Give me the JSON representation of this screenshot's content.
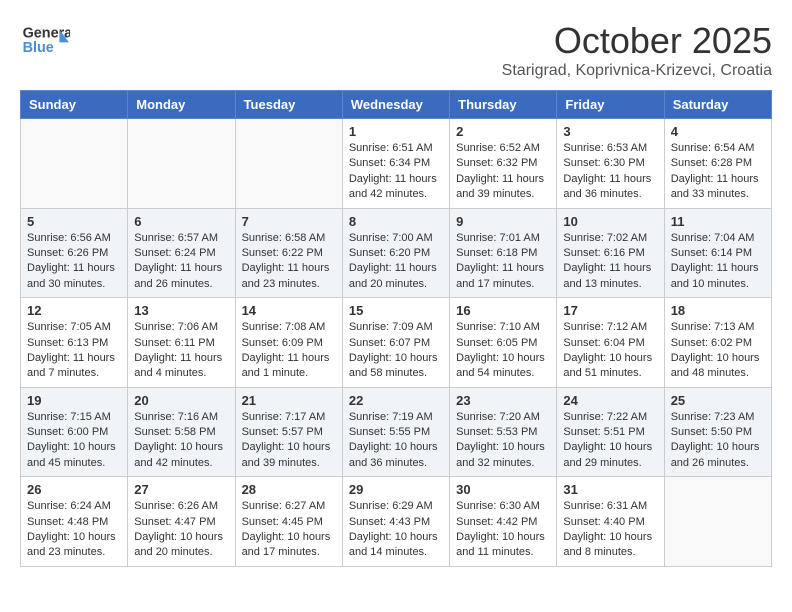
{
  "header": {
    "logo_general": "General",
    "logo_blue": "Blue",
    "month": "October 2025",
    "location": "Starigrad, Koprivnica-Krizevci, Croatia"
  },
  "weekdays": [
    "Sunday",
    "Monday",
    "Tuesday",
    "Wednesday",
    "Thursday",
    "Friday",
    "Saturday"
  ],
  "weeks": [
    [
      {
        "day": "",
        "info": ""
      },
      {
        "day": "",
        "info": ""
      },
      {
        "day": "",
        "info": ""
      },
      {
        "day": "1",
        "info": "Sunrise: 6:51 AM\nSunset: 6:34 PM\nDaylight: 11 hours\nand 42 minutes."
      },
      {
        "day": "2",
        "info": "Sunrise: 6:52 AM\nSunset: 6:32 PM\nDaylight: 11 hours\nand 39 minutes."
      },
      {
        "day": "3",
        "info": "Sunrise: 6:53 AM\nSunset: 6:30 PM\nDaylight: 11 hours\nand 36 minutes."
      },
      {
        "day": "4",
        "info": "Sunrise: 6:54 AM\nSunset: 6:28 PM\nDaylight: 11 hours\nand 33 minutes."
      }
    ],
    [
      {
        "day": "5",
        "info": "Sunrise: 6:56 AM\nSunset: 6:26 PM\nDaylight: 11 hours\nand 30 minutes."
      },
      {
        "day": "6",
        "info": "Sunrise: 6:57 AM\nSunset: 6:24 PM\nDaylight: 11 hours\nand 26 minutes."
      },
      {
        "day": "7",
        "info": "Sunrise: 6:58 AM\nSunset: 6:22 PM\nDaylight: 11 hours\nand 23 minutes."
      },
      {
        "day": "8",
        "info": "Sunrise: 7:00 AM\nSunset: 6:20 PM\nDaylight: 11 hours\nand 20 minutes."
      },
      {
        "day": "9",
        "info": "Sunrise: 7:01 AM\nSunset: 6:18 PM\nDaylight: 11 hours\nand 17 minutes."
      },
      {
        "day": "10",
        "info": "Sunrise: 7:02 AM\nSunset: 6:16 PM\nDaylight: 11 hours\nand 13 minutes."
      },
      {
        "day": "11",
        "info": "Sunrise: 7:04 AM\nSunset: 6:14 PM\nDaylight: 11 hours\nand 10 minutes."
      }
    ],
    [
      {
        "day": "12",
        "info": "Sunrise: 7:05 AM\nSunset: 6:13 PM\nDaylight: 11 hours\nand 7 minutes."
      },
      {
        "day": "13",
        "info": "Sunrise: 7:06 AM\nSunset: 6:11 PM\nDaylight: 11 hours\nand 4 minutes."
      },
      {
        "day": "14",
        "info": "Sunrise: 7:08 AM\nSunset: 6:09 PM\nDaylight: 11 hours\nand 1 minute."
      },
      {
        "day": "15",
        "info": "Sunrise: 7:09 AM\nSunset: 6:07 PM\nDaylight: 10 hours\nand 58 minutes."
      },
      {
        "day": "16",
        "info": "Sunrise: 7:10 AM\nSunset: 6:05 PM\nDaylight: 10 hours\nand 54 minutes."
      },
      {
        "day": "17",
        "info": "Sunrise: 7:12 AM\nSunset: 6:04 PM\nDaylight: 10 hours\nand 51 minutes."
      },
      {
        "day": "18",
        "info": "Sunrise: 7:13 AM\nSunset: 6:02 PM\nDaylight: 10 hours\nand 48 minutes."
      }
    ],
    [
      {
        "day": "19",
        "info": "Sunrise: 7:15 AM\nSunset: 6:00 PM\nDaylight: 10 hours\nand 45 minutes."
      },
      {
        "day": "20",
        "info": "Sunrise: 7:16 AM\nSunset: 5:58 PM\nDaylight: 10 hours\nand 42 minutes."
      },
      {
        "day": "21",
        "info": "Sunrise: 7:17 AM\nSunset: 5:57 PM\nDaylight: 10 hours\nand 39 minutes."
      },
      {
        "day": "22",
        "info": "Sunrise: 7:19 AM\nSunset: 5:55 PM\nDaylight: 10 hours\nand 36 minutes."
      },
      {
        "day": "23",
        "info": "Sunrise: 7:20 AM\nSunset: 5:53 PM\nDaylight: 10 hours\nand 32 minutes."
      },
      {
        "day": "24",
        "info": "Sunrise: 7:22 AM\nSunset: 5:51 PM\nDaylight: 10 hours\nand 29 minutes."
      },
      {
        "day": "25",
        "info": "Sunrise: 7:23 AM\nSunset: 5:50 PM\nDaylight: 10 hours\nand 26 minutes."
      }
    ],
    [
      {
        "day": "26",
        "info": "Sunrise: 6:24 AM\nSunset: 4:48 PM\nDaylight: 10 hours\nand 23 minutes."
      },
      {
        "day": "27",
        "info": "Sunrise: 6:26 AM\nSunset: 4:47 PM\nDaylight: 10 hours\nand 20 minutes."
      },
      {
        "day": "28",
        "info": "Sunrise: 6:27 AM\nSunset: 4:45 PM\nDaylight: 10 hours\nand 17 minutes."
      },
      {
        "day": "29",
        "info": "Sunrise: 6:29 AM\nSunset: 4:43 PM\nDaylight: 10 hours\nand 14 minutes."
      },
      {
        "day": "30",
        "info": "Sunrise: 6:30 AM\nSunset: 4:42 PM\nDaylight: 10 hours\nand 11 minutes."
      },
      {
        "day": "31",
        "info": "Sunrise: 6:31 AM\nSunset: 4:40 PM\nDaylight: 10 hours\nand 8 minutes."
      },
      {
        "day": "",
        "info": ""
      }
    ]
  ]
}
